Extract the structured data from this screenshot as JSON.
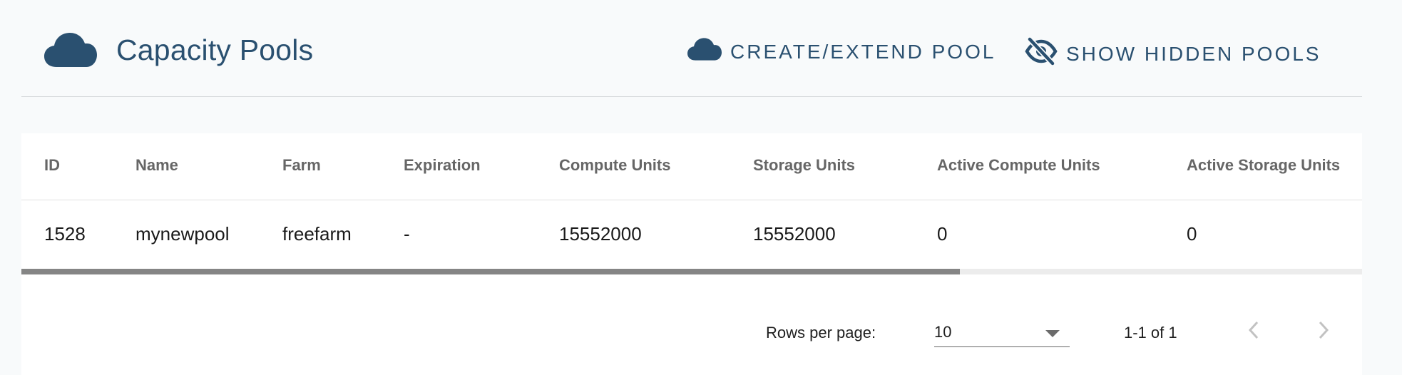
{
  "header": {
    "title": "Capacity Pools",
    "icon": "cloud-icon",
    "actions": {
      "create_label": "CREATE/EXTEND POOL",
      "create_icon": "cloud-icon",
      "show_hidden_label": "SHOW HIDDEN POOLS",
      "show_hidden_icon": "eye-off-icon"
    }
  },
  "table": {
    "columns": [
      "ID",
      "Name",
      "Farm",
      "Expiration",
      "Compute Units",
      "Storage Units",
      "Active Compute Units",
      "Active Storage Units"
    ],
    "rows": [
      [
        "1528",
        "mynewpool",
        "freefarm",
        "-",
        "15552000",
        "15552000",
        "0",
        "0"
      ]
    ],
    "scroll_position": 0.7
  },
  "pagination": {
    "rows_per_page_label": "Rows per page:",
    "rows_per_page_value": "10",
    "range_text": "1-1 of 1",
    "prev_icon": "chevron-left-icon",
    "next_icon": "chevron-right-icon"
  },
  "colors": {
    "accent": "#2a5070",
    "header_text": "#666666",
    "scroll_thumb": "#858585"
  }
}
